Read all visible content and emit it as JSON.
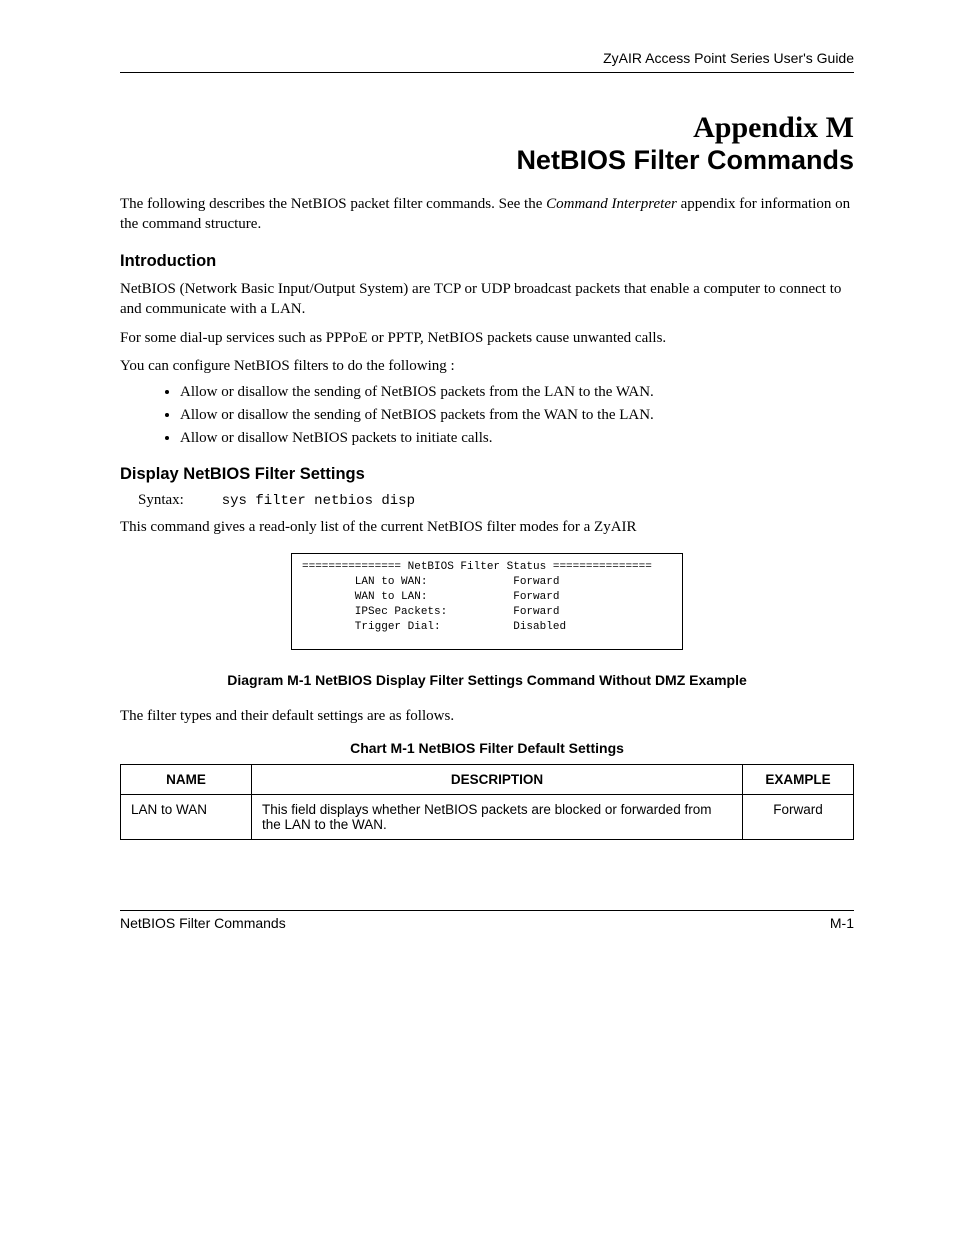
{
  "header": {
    "guide_title": "ZyAIR Access Point Series User's Guide"
  },
  "title": {
    "appendix": "Appendix M",
    "subtitle": "NetBIOS Filter Commands"
  },
  "intro_paragraph": {
    "part1": "The following describes the NetBIOS packet filter commands. See the ",
    "italic": "Command Interpreter",
    "part2": " appendix for information on the command structure."
  },
  "sections": {
    "introduction": {
      "heading": "Introduction",
      "p1": "NetBIOS (Network Basic Input/Output System) are TCP or UDP broadcast packets that enable a computer to connect to and communicate with a LAN.",
      "p2": "For some dial-up services such as PPPoE or PPTP, NetBIOS packets cause unwanted calls.",
      "p3": "You can configure NetBIOS filters to do the following :",
      "bullets": [
        "Allow or disallow the sending of NetBIOS packets from the LAN to the WAN.",
        "Allow or disallow the sending of NetBIOS packets from the WAN to the LAN.",
        "Allow or disallow NetBIOS packets to initiate calls."
      ]
    },
    "display_settings": {
      "heading": "Display NetBIOS Filter Settings",
      "syntax_label": "Syntax:",
      "syntax_command": "sys filter netbios disp",
      "p1": "This command gives a read-only list of the current NetBIOS filter modes for a ZyAIR",
      "code_box": "=============== NetBIOS Filter Status ===============\n        LAN to WAN:             Forward\n        WAN to LAN:             Forward\n        IPSec Packets:          Forward\n        Trigger Dial:           Disabled",
      "diagram_caption": "Diagram M-1 NetBIOS Display Filter Settings Command Without DMZ Example",
      "p2": "The filter types and their default settings are as follows.",
      "chart_caption": "Chart M-1 NetBIOS Filter Default Settings",
      "table": {
        "headers": {
          "name": "NAME",
          "description": "DESCRIPTION",
          "example": "EXAMPLE"
        },
        "rows": [
          {
            "name": "LAN to WAN",
            "description": "This field displays whether NetBIOS packets are blocked or forwarded from the LAN to the WAN.",
            "example": "Forward"
          }
        ]
      }
    }
  },
  "footer": {
    "section_name": "NetBIOS Filter Commands",
    "page_number": "M-1"
  }
}
